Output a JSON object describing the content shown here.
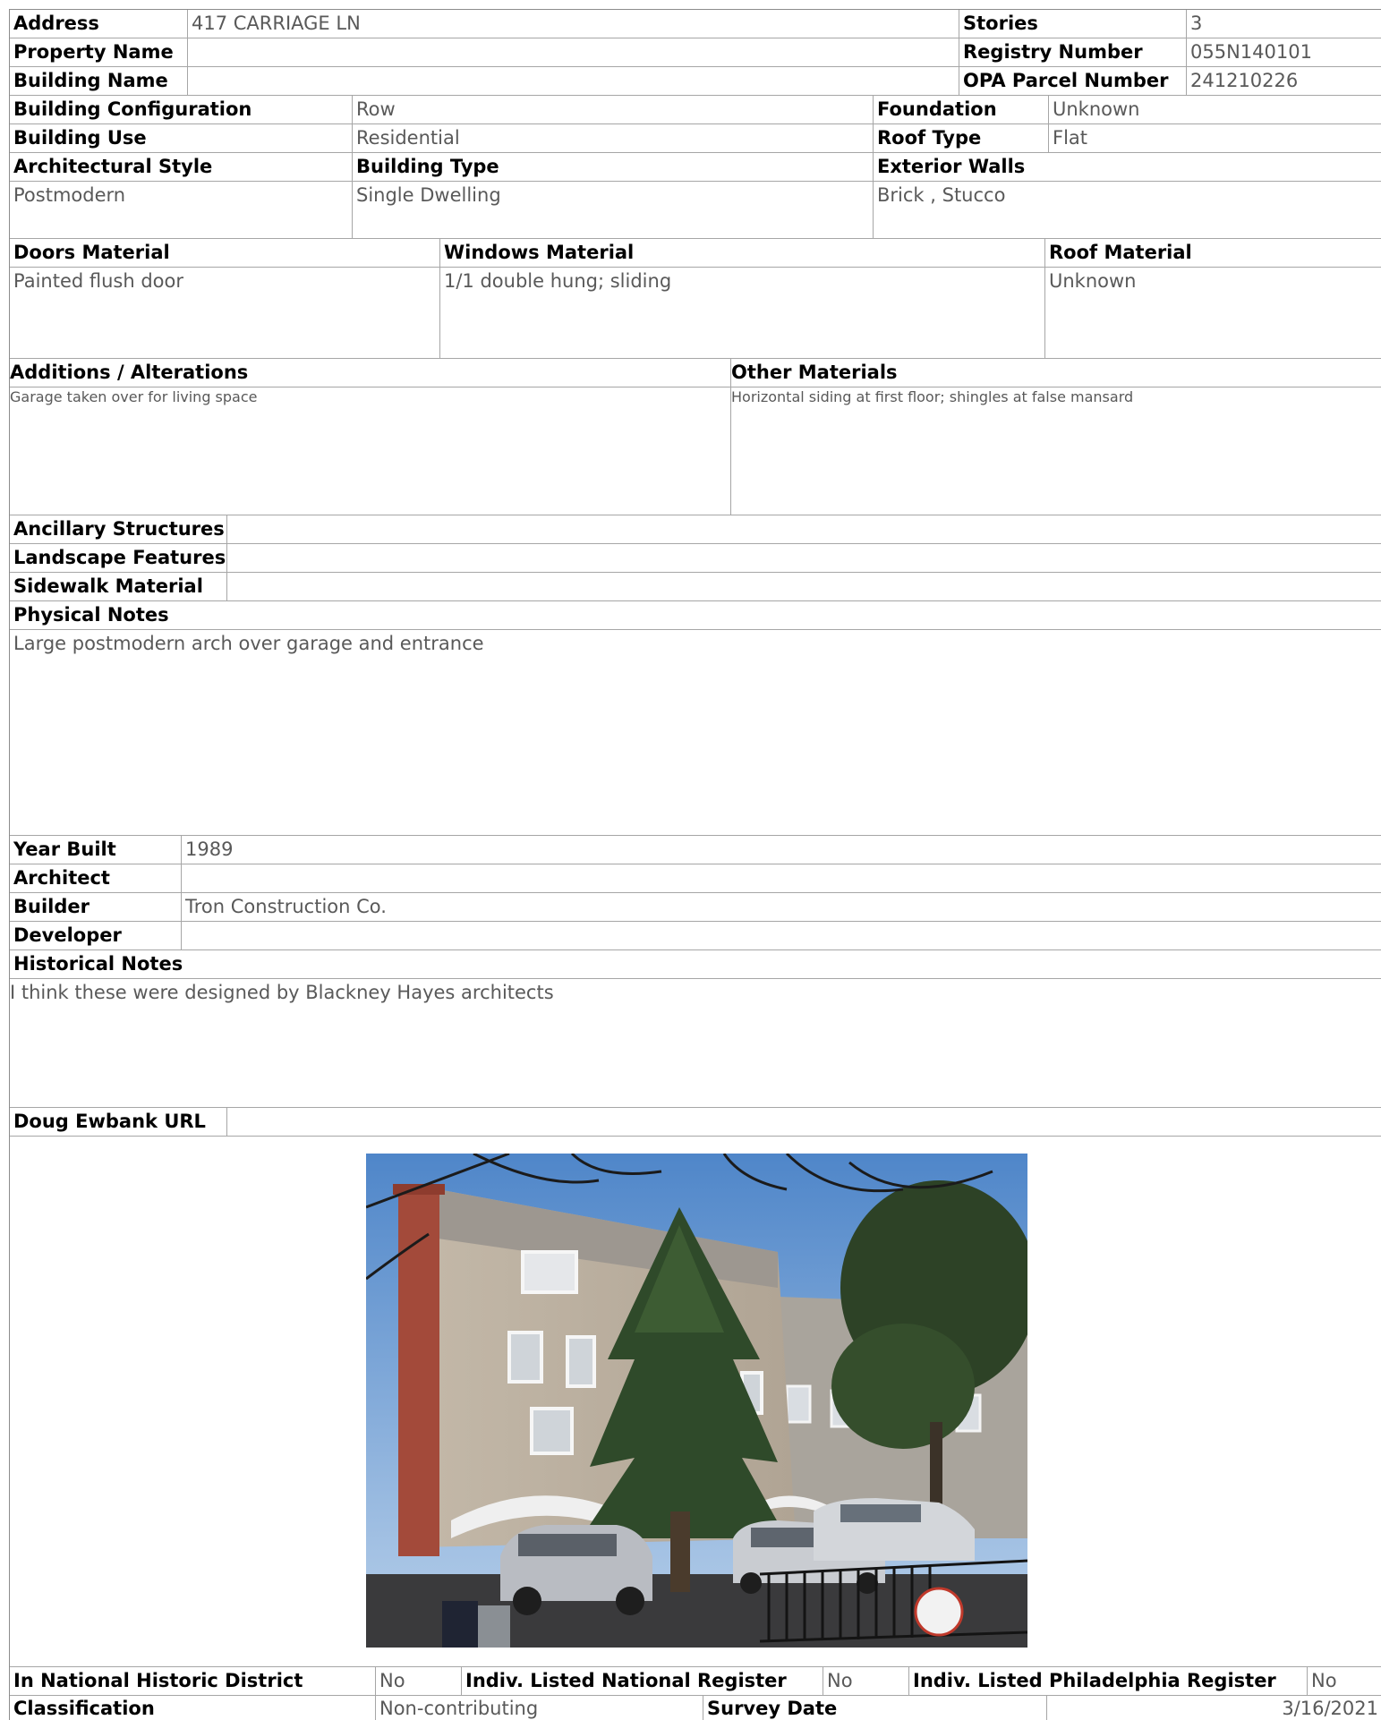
{
  "header": {
    "address_label": "Address",
    "address_value": "417 CARRIAGE LN",
    "property_name_label": "Property Name",
    "property_name_value": "",
    "building_name_label": "Building Name",
    "building_name_value": "",
    "stories_label": "Stories",
    "stories_value": "3",
    "registry_number_label": "Registry Number",
    "registry_number_value": "055N140101",
    "opa_parcel_label": "OPA Parcel Number",
    "opa_parcel_value": "241210226"
  },
  "building": {
    "configuration_label": "Building Configuration",
    "configuration_value": "Row",
    "use_label": "Building Use",
    "use_value": "Residential",
    "foundation_label": "Foundation",
    "foundation_value": "Unknown",
    "roof_type_label": "Roof Type",
    "roof_type_value": "Flat",
    "style_label": "Architectural Style",
    "style_value": "Postmodern",
    "type_label": "Building Type",
    "type_value": "Single Dwelling",
    "exterior_walls_label": "Exterior Walls",
    "exterior_walls_value": "Brick , Stucco"
  },
  "materials": {
    "doors_label": "Doors Material",
    "doors_value": "Painted flush door",
    "windows_label": "Windows Material",
    "windows_value": "1/1 double hung; sliding",
    "roof_label": "Roof Material",
    "roof_value": "Unknown"
  },
  "alterations": {
    "additions_label": "Additions / Alterations",
    "additions_value": "Garage taken over for living space",
    "other_label": "Other Materials",
    "other_value": "Horizontal siding at first floor; shingles at false mansard"
  },
  "site": {
    "ancillary_label": "Ancillary Structures",
    "ancillary_value": "",
    "landscape_label": "Landscape Features",
    "landscape_value": "",
    "sidewalk_label": "Sidewalk Material",
    "sidewalk_value": "",
    "physical_notes_label": "Physical Notes",
    "physical_notes_value": "Large postmodern arch over garage and entrance"
  },
  "history": {
    "year_built_label": "Year Built",
    "year_built_value": "1989",
    "architect_label": "Architect",
    "architect_value": "",
    "builder_label": "Builder",
    "builder_value": "Tron Construction Co.",
    "developer_label": "Developer",
    "developer_value": "",
    "historical_notes_label": "Historical Notes",
    "historical_notes_value": "I think these were designed by Blackney Hayes architects",
    "doug_ewbank_label": "Doug Ewbank URL",
    "doug_ewbank_value": ""
  },
  "photo": {
    "subject": "building-photo"
  },
  "register": {
    "national_district_label": "In National Historic District",
    "national_district_value": "No",
    "national_register_label": "Indiv. Listed National Register",
    "national_register_value": "No",
    "philadelphia_register_label": "Indiv. Listed Philadelphia Register",
    "philadelphia_register_value": "No",
    "classification_label": "Classification",
    "classification_value": "Non-contributing",
    "survey_date_label": "Survey Date",
    "survey_date_value": "3/16/2021"
  }
}
